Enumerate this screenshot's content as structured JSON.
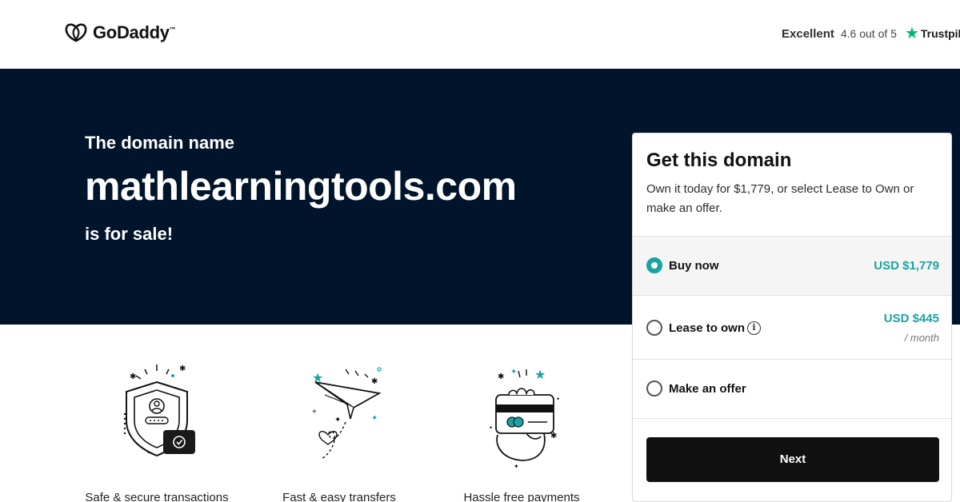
{
  "header": {
    "logo_text": "GoDaddy",
    "logo_tm": "™",
    "trust_label": "Excellent",
    "trust_rating": "4.6 out of 5",
    "trust_star_icon": "star-icon",
    "trust_brand": "Trustpilot"
  },
  "hero": {
    "pre_text": "The domain name",
    "domain": "mathlearningtools.com",
    "post_text": "is for sale!"
  },
  "features": [
    {
      "label": "Safe & secure transactions",
      "icon": "shield-icon"
    },
    {
      "label": "Fast & easy transfers",
      "icon": "paper-plane-icon"
    },
    {
      "label": "Hassle free payments",
      "icon": "card-hand-icon"
    }
  ],
  "card": {
    "title": "Get this domain",
    "description": "Own it today for $1,779, or select Lease to Own or make an offer.",
    "options": [
      {
        "label": "Buy now",
        "price": "USD $1,779",
        "sub": "",
        "selected": true
      },
      {
        "label": "Lease to own",
        "price": "USD $445",
        "sub": "/ month",
        "selected": false
      },
      {
        "label": "Make an offer",
        "price": "",
        "sub": "",
        "selected": false
      }
    ],
    "next_label": "Next"
  },
  "colors": {
    "hero_bg": "#00142b",
    "accent_teal": "#1ba3a3",
    "trustpilot_green": "#00b67a",
    "button_bg": "#111111"
  }
}
